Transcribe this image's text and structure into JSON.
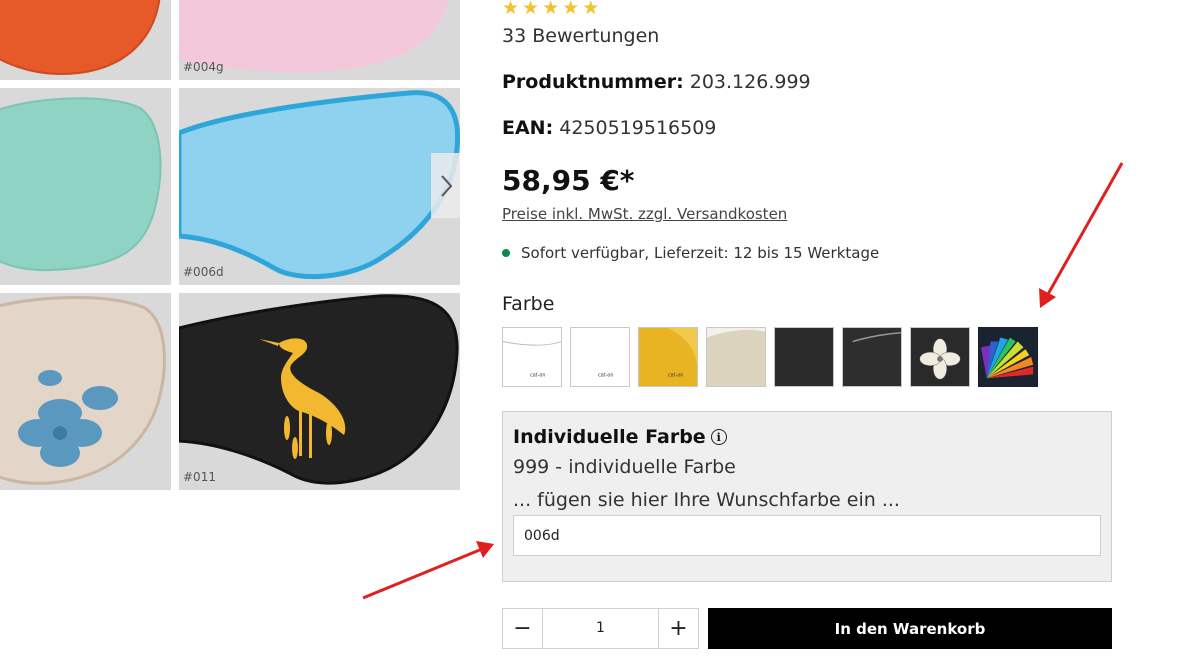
{
  "gallery": {
    "tiles": [
      {
        "code": "",
        "color": "#e65a2a",
        "icon": "eye-mask-orange"
      },
      {
        "code": "#004g",
        "color": "#f3c8da",
        "icon": "eye-mask-pink"
      },
      {
        "code": "",
        "color": "#8fd3c4",
        "icon": "eye-mask-mint"
      },
      {
        "code": "#006d",
        "color": "#78c8ea",
        "icon": "eye-mask-light-blue"
      },
      {
        "code": "",
        "color": "#e3d5c7",
        "icon": "eye-mask-beige-hibiscus"
      },
      {
        "code": "#011",
        "color": "#222222",
        "icon": "eye-mask-black-heron"
      }
    ],
    "next_icon": "chevron-right-icon"
  },
  "product": {
    "rating_stars": 5,
    "reviews": "33 Bewertungen",
    "product_number_label": "Produktnummer:",
    "product_number": "203.126.999",
    "ean_label": "EAN:",
    "ean": "4250519516509",
    "price": "58,95 €*",
    "price_note": "Preise inkl. MwSt. zzgl. Versandkosten",
    "stock": "Sofort verfügbar, Lieferzeit: 12 bis 15 Werktage",
    "stock_color": "#0c8a4e"
  },
  "color_option": {
    "label": "Farbe",
    "swatches": [
      {
        "name": "white-1",
        "logo": "cat-on"
      },
      {
        "name": "white-2",
        "logo": "cat-on"
      },
      {
        "name": "yellow",
        "logo": "cat-on"
      },
      {
        "name": "beige"
      },
      {
        "name": "black-1"
      },
      {
        "name": "black-2"
      },
      {
        "name": "black-flower"
      },
      {
        "name": "rainbow-custom",
        "selected": true
      }
    ]
  },
  "individual_color": {
    "title": "Individuelle Farbe",
    "info_icon": "info-icon",
    "value": "999 - individuelle Farbe",
    "hint": "... fügen sie hier Ihre Wunschfarbe ein ...",
    "input_value": "006d"
  },
  "cart": {
    "quantity": "1",
    "minus": "−",
    "plus": "+",
    "button_label": "In den Warenkorb"
  },
  "annotations": {
    "arrow_color": "#e02020"
  }
}
